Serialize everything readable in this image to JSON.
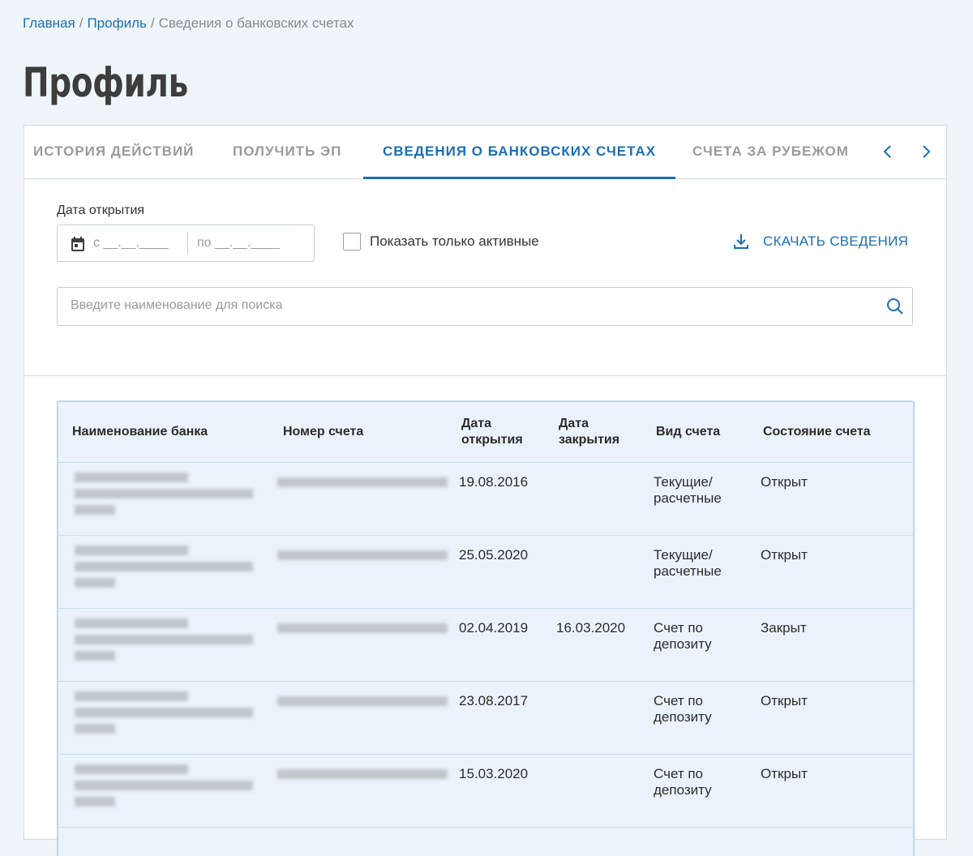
{
  "breadcrumb": {
    "home": "Главная",
    "profile": "Профиль",
    "sep1": "/",
    "sep2": "/",
    "current": "Сведения о банковских счетах"
  },
  "page": {
    "title": "Профиль"
  },
  "tabs": [
    {
      "label": "ИСТОРИЯ ДЕЙСТВИЙ"
    },
    {
      "label": "ПОЛУЧИТЬ ЭП"
    },
    {
      "label": "СВЕДЕНИЯ О БАНКОВСКИХ СЧЕТАХ",
      "active": true
    },
    {
      "label": "СЧЕТА ЗА РУБЕЖОМ"
    }
  ],
  "filters": {
    "date_label": "Дата открытия",
    "date_from": "с __.__.____",
    "date_to": "по __.__.____",
    "active_only_label": "Показать только активные",
    "active_only_checked": false,
    "download_label": "СКАЧАТЬ СВЕДЕНИЯ",
    "search_placeholder": "Введите наименование для поиска",
    "search_value": ""
  },
  "table": {
    "headers": {
      "bank": "Наименование банка",
      "account": "Номер счета",
      "opened_l1": "Дата",
      "opened_l2": "открытия",
      "closed_l1": "Дата",
      "closed_l2": "закрытия",
      "type": "Вид счета",
      "state": "Состояние счета"
    },
    "rows": [
      {
        "opened": "19.08.2016",
        "closed": "",
        "type_l1": "Текущие/",
        "type_l2": "расчетные",
        "state": "Открыт"
      },
      {
        "opened": "25.05.2020",
        "closed": "",
        "type_l1": "Текущие/",
        "type_l2": "расчетные",
        "state": "Открыт"
      },
      {
        "opened": "02.04.2019",
        "closed": "16.03.2020",
        "type_l1": "Счет по",
        "type_l2": "депозиту",
        "state": "Закрыт"
      },
      {
        "opened": "23.08.2017",
        "closed": "",
        "type_l1": "Счет по",
        "type_l2": "депозиту",
        "state": "Открыт"
      },
      {
        "opened": "15.03.2020",
        "closed": "",
        "type_l1": "Счет по",
        "type_l2": "депозиту",
        "state": "Открыт"
      }
    ]
  },
  "colors": {
    "accent": "#1a6fb5",
    "muted": "#9a9a9a",
    "table_bg": "#eaf3fb",
    "table_border": "#b9d8f0"
  },
  "icons": {
    "calendar": "calendar-icon",
    "download": "download-icon",
    "search": "search-icon",
    "prev": "chevron-left-icon",
    "next": "chevron-right-icon"
  }
}
